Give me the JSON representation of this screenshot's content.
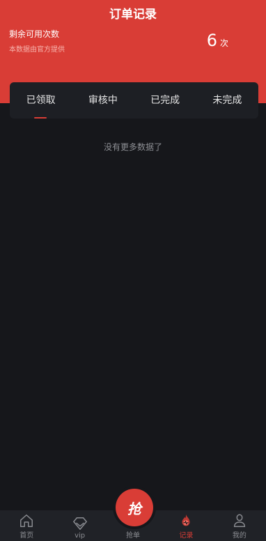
{
  "header": {
    "title": "订单记录",
    "remain_label": "剩余可用次数",
    "remain_source": "本数据由官方提供",
    "count": "6",
    "count_unit": "次"
  },
  "tabs": [
    {
      "label": "已领取",
      "active": true
    },
    {
      "label": "审核中",
      "active": false
    },
    {
      "label": "已完成",
      "active": false
    },
    {
      "label": "未完成",
      "active": false
    }
  ],
  "empty_text": "没有更多数据了",
  "nav": {
    "items": [
      {
        "label": "首页",
        "icon": "home-icon"
      },
      {
        "label": "vip",
        "icon": "diamond-icon"
      },
      {
        "label": "抢单",
        "icon": "grab-icon"
      },
      {
        "label": "记录",
        "icon": "record-icon",
        "active": true
      },
      {
        "label": "我的",
        "icon": "user-icon"
      }
    ],
    "grab_glyph": "抢"
  },
  "colors": {
    "accent": "#d93d36",
    "background": "#16171b",
    "nav_bg": "#202227"
  }
}
